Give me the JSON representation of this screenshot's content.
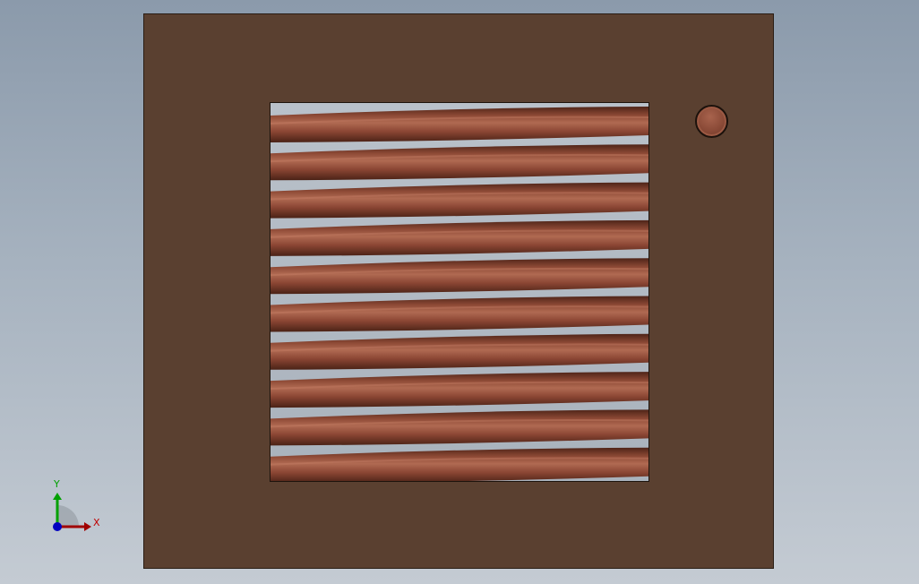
{
  "viewport": {
    "background_top": "#8b9aab",
    "background_bottom": "#c4cbd3"
  },
  "model": {
    "plate_color": "#5a4030",
    "coil_color": "#9a5642",
    "coil_count": 10,
    "hole_color": "#8a4a37"
  },
  "triad": {
    "x_label": "X",
    "y_label": "Y",
    "x_color": "#c00000",
    "y_color": "#00a000",
    "z_color": "#0000c0"
  }
}
